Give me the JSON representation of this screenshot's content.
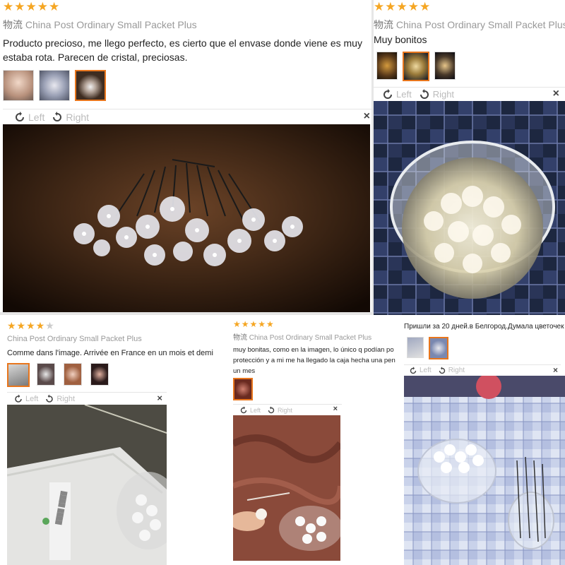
{
  "reviews": [
    {
      "stars": 5,
      "shipping_prefix": "物流",
      "shipping_method": "China Post Ordinary Small Packet Plus",
      "text": "Producto precioso, me llego perfecto, es cierto que el envase donde viene es muy estaba rota. Parecen de cristal, preciosas.",
      "rotate_left": "Left",
      "rotate_right": "Right",
      "close": "×",
      "thumb_count": 3,
      "active_thumb": 3
    },
    {
      "stars": 5,
      "shipping_prefix": "物流",
      "shipping_method": "China Post Ordinary Small Packet Plus",
      "text": "Muy bonitos",
      "rotate_left": "Left",
      "rotate_right": "Right",
      "close": "×",
      "thumb_count": 3,
      "active_thumb": 2
    },
    {
      "stars": 4,
      "shipping_prefix": "",
      "shipping_method": "China Post Ordinary Small Packet Plus",
      "text": "Comme dans l'image. Arrivée en France en un mois et demi",
      "rotate_left": "Left",
      "rotate_right": "Right",
      "close": "×",
      "thumb_count": 4,
      "active_thumb": 1
    },
    {
      "stars": 5,
      "shipping_prefix": "物流",
      "shipping_method": "China Post Ordinary Small Packet Plus",
      "text": "muy bonitas, como en la imagen, lo único q podían po protección y a mi me ha llegado la caja hecha una pen un mes",
      "rotate_left": "Left",
      "rotate_right": "Right",
      "close": "×",
      "thumb_count": 1,
      "active_thumb": 1
    },
    {
      "stars": 0,
      "shipping_prefix": "",
      "shipping_method": "",
      "text": "Пришли за 20 дней.в Белгород.Думала цветочек",
      "rotate_left": "Left",
      "rotate_right": "Right",
      "close": "×",
      "thumb_count": 2,
      "active_thumb": 2
    }
  ],
  "colors": {
    "star": "#f5a623",
    "accent": "#e8761d",
    "muted": "#999999"
  }
}
